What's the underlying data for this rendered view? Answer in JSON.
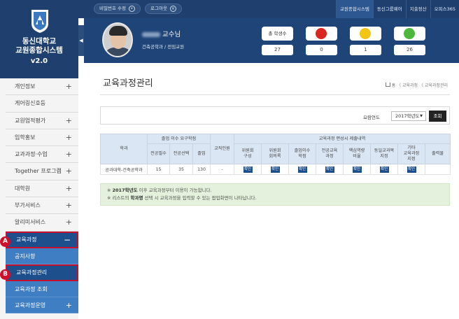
{
  "brand": {
    "title_line1": "동신대학교",
    "title_line2": "교원종합시스템",
    "version": "v2.0"
  },
  "topbar": {
    "change_password": "비밀번호 수정",
    "logout": "로그아웃",
    "links": [
      "교원종합시스템",
      "동신그룹웨어",
      "지출정산",
      "오피스365"
    ],
    "current_link": "교원종합시스템"
  },
  "profile": {
    "title": "교수님",
    "department": "건축공학과 / 전임교원",
    "stats": {
      "total_label": "총 학생수",
      "total": "27",
      "red": "0",
      "yellow": "1",
      "green": "26"
    }
  },
  "colors": {
    "navy": "#1f3f6e",
    "nav_active": "#1d4f8c",
    "submenu": "#3f7ec2",
    "highlight_border": "#c8102e",
    "red": "#d9271f",
    "yellow": "#f2c417",
    "green": "#4db83c",
    "notice_bg": "#e4f1dc"
  },
  "sidebar": {
    "items": [
      {
        "label": "개인정보",
        "expandable": true
      },
      {
        "label": "게어링신호등",
        "expandable": false
      },
      {
        "label": "교원업적평가",
        "expandable": true
      },
      {
        "label": "입학홍보",
        "expandable": true
      },
      {
        "label": "교과과정·수업",
        "expandable": true
      },
      {
        "label": "Together 프로그램",
        "expandable": true
      },
      {
        "label": "대학원",
        "expandable": true
      },
      {
        "label": "부가서비스",
        "expandable": true
      },
      {
        "label": "알리미서비스",
        "expandable": true
      }
    ],
    "open_section": {
      "label": "교육과정",
      "toggle": "−"
    },
    "sub_items": [
      {
        "label": "공지사항"
      },
      {
        "label": "교육과정관리"
      },
      {
        "label": "교육과정 조회"
      },
      {
        "label": "교육과정운영"
      }
    ],
    "markers": {
      "a": "A",
      "b": "B"
    }
  },
  "page": {
    "title": "교육과정관리",
    "breadcrumb": "홈 〈 교육과정 〈 교육과정관리"
  },
  "filter": {
    "label": "요람연도",
    "selected_year": "2017학년도",
    "search_button": "조회"
  },
  "table": {
    "header": {
      "dept": "학과",
      "grad_req": "졸업 이수 요구학점",
      "major_required": "전공필수",
      "major_elective": "전공선택",
      "total": "졸업",
      "faculty": "교직인원",
      "submission": "교육과정 편성시 제출내역",
      "committee_comp": [
        "위원회",
        "구성"
      ],
      "committee_minutes": [
        "위원회",
        "회의록"
      ],
      "grad_credits": [
        "졸업이수",
        "학점"
      ],
      "major_course": [
        "전공교육",
        "과정"
      ],
      "core_competency": [
        "핵심역량",
        "비율"
      ],
      "same_course": [
        "동일교과목",
        "지정"
      ],
      "other_course": [
        "기타",
        "교육과정",
        "지정"
      ],
      "export": "출력물"
    },
    "rows": [
      {
        "dept": "공과대학-건축공학과",
        "major_required": "15",
        "major_elective": "35",
        "total": "130",
        "faculty": "-",
        "confirm": "확인"
      }
    ]
  },
  "notice": {
    "line1_year": "2017학년도",
    "line1_rest": "이후 교육과정부터 이용이 가능합니다.",
    "line2_prefix": "리스트의",
    "line2_bold": "학과명",
    "line2_rest": "선택 시 교육과정을 입력할 수 있는 팝업화면이 나타납니다."
  }
}
